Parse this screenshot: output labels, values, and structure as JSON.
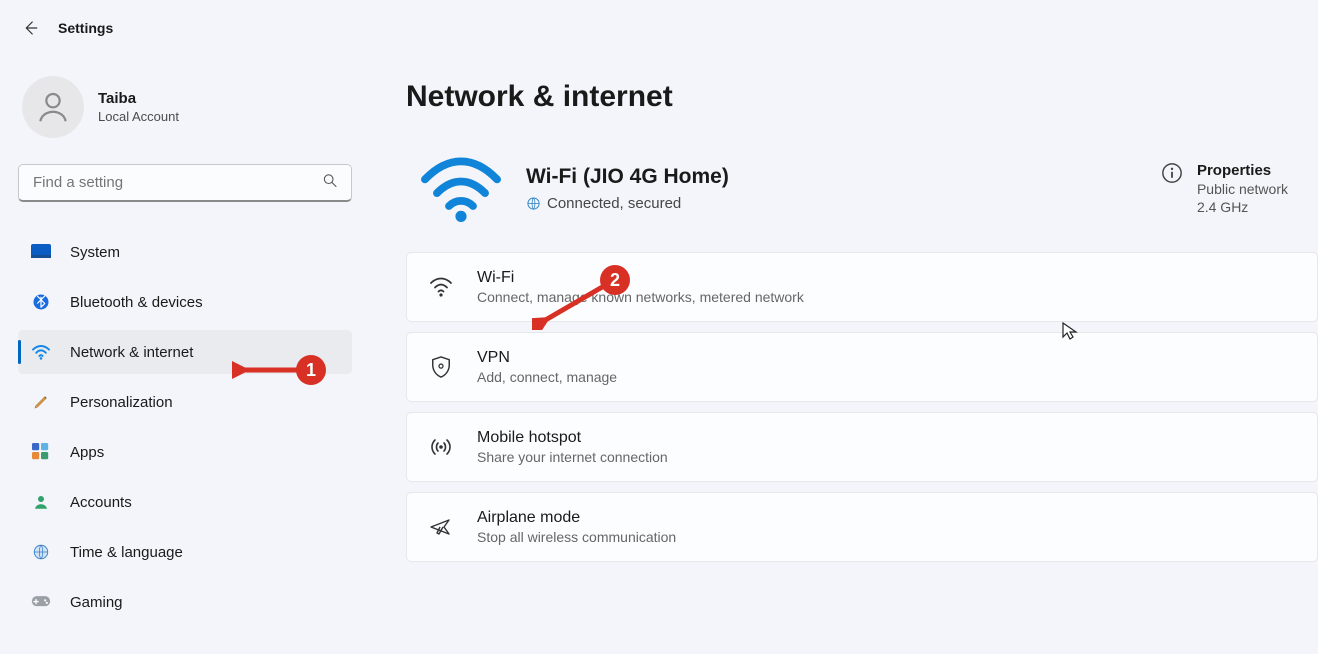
{
  "header": {
    "title": "Settings"
  },
  "profile": {
    "name": "Taiba",
    "sub": "Local Account"
  },
  "search": {
    "placeholder": "Find a setting"
  },
  "sidebar": {
    "items": [
      {
        "label": "System"
      },
      {
        "label": "Bluetooth & devices"
      },
      {
        "label": "Network & internet"
      },
      {
        "label": "Personalization"
      },
      {
        "label": "Apps"
      },
      {
        "label": "Accounts"
      },
      {
        "label": "Time & language"
      },
      {
        "label": "Gaming"
      }
    ]
  },
  "main": {
    "title": "Network & internet",
    "status": {
      "title": "Wi-Fi (JIO 4G Home)",
      "sub": "Connected, secured"
    },
    "properties": {
      "title": "Properties",
      "line1": "Public network",
      "line2": "2.4 GHz"
    },
    "cards": [
      {
        "title": "Wi-Fi",
        "sub": "Connect, manage known networks, metered network"
      },
      {
        "title": "VPN",
        "sub": "Add, connect, manage"
      },
      {
        "title": "Mobile hotspot",
        "sub": "Share your internet connection"
      },
      {
        "title": "Airplane mode",
        "sub": "Stop all wireless communication"
      }
    ]
  },
  "annotations": {
    "badge1": "1",
    "badge2": "2"
  }
}
